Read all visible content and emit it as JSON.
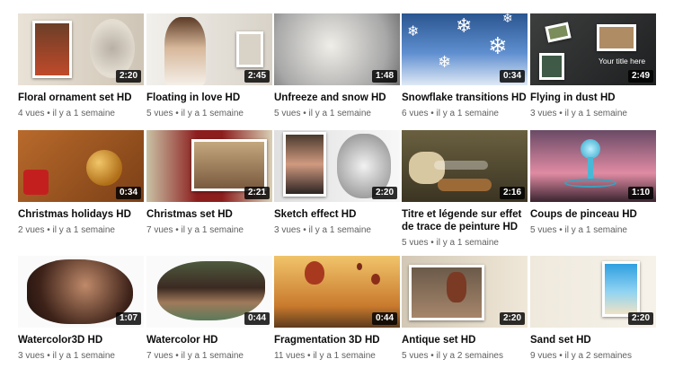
{
  "videos": [
    {
      "title": "Floral ornament set HD",
      "duration": "2:20",
      "meta": "4 vues • il y a 1 semaine",
      "thumb_icon": "portrait-ornament-thumbnail"
    },
    {
      "title": "Floating in love HD",
      "duration": "2:45",
      "meta": "5 vues • il y a 1 semaine",
      "thumb_icon": "bride-thumbnail"
    },
    {
      "title": "Unfreeze and snow HD",
      "duration": "1:48",
      "meta": "5 vues • il y a 1 semaine",
      "thumb_icon": "frozen-face-thumbnail"
    },
    {
      "title": "Snowflake transitions HD",
      "duration": "0:34",
      "meta": "6 vues • il y a 1 semaine",
      "thumb_icon": "snowflakes-thumbnail"
    },
    {
      "title": "Flying in dust HD",
      "duration": "2:49",
      "meta": "3 vues • il y a 1 semaine",
      "thumb_icon": "flying-photos-thumbnail",
      "overlay_text": "Your title here"
    },
    {
      "title": "Christmas holidays HD",
      "duration": "0:34",
      "meta": "2 vues • il y a 1 semaine",
      "thumb_icon": "christmas-ornaments-thumbnail"
    },
    {
      "title": "Christmas set HD",
      "duration": "2:21",
      "meta": "7 vues • il y a 1 semaine",
      "thumb_icon": "christmas-frame-thumbnail"
    },
    {
      "title": "Sketch effect HD",
      "duration": "2:20",
      "meta": "3 vues • il y a 1 semaine",
      "thumb_icon": "sketch-portrait-thumbnail"
    },
    {
      "title": "Titre et légende sur effet de trace de peinture HD",
      "duration": "2:16",
      "meta": "5 vues • il y a 1 semaine",
      "thumb_icon": "nuts-bag-thumbnail"
    },
    {
      "title": "Coups de pinceau HD",
      "duration": "1:10",
      "meta": "5 vues • il y a 1 semaine",
      "thumb_icon": "water-drop-thumbnail"
    },
    {
      "title": "Watercolor3D HD",
      "duration": "1:07",
      "meta": "3 vues • il y a 1 semaine",
      "thumb_icon": "watercolor-portrait-thumbnail"
    },
    {
      "title": "Watercolor HD",
      "duration": "0:44",
      "meta": "7 vues • il y a 1 semaine",
      "thumb_icon": "watercolor-eyes-thumbnail"
    },
    {
      "title": "Fragmentation 3D HD",
      "duration": "0:44",
      "meta": "11 vues • il y a 1 semaine",
      "thumb_icon": "balloons-thumbnail"
    },
    {
      "title": "Antique set HD",
      "duration": "2:20",
      "meta": "5 vues • il y a 2 semaines",
      "thumb_icon": "pottery-thumbnail"
    },
    {
      "title": "Sand set HD",
      "duration": "2:20",
      "meta": "9 vues • il y a 2 semaines",
      "thumb_icon": "beach-thumbnail"
    }
  ]
}
